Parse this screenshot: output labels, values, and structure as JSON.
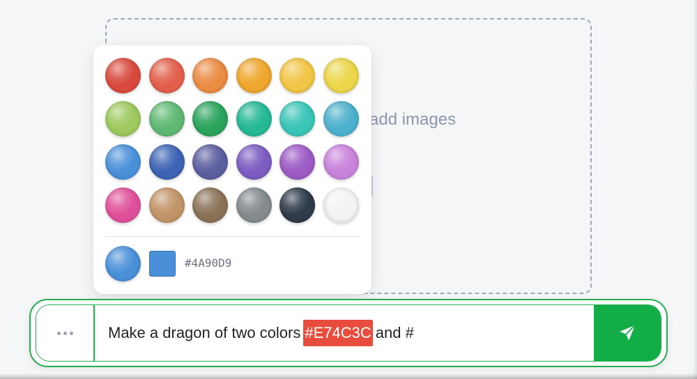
{
  "dropzone": {
    "hint_text": "n add images"
  },
  "picker": {
    "swatches": [
      {
        "name": "red",
        "color": "#d94a3d"
      },
      {
        "name": "vermilion",
        "color": "#e2604b"
      },
      {
        "name": "orange",
        "color": "#ea8c43"
      },
      {
        "name": "amber",
        "color": "#efa72e"
      },
      {
        "name": "gold",
        "color": "#f1c545"
      },
      {
        "name": "yellow",
        "color": "#ecd64a"
      },
      {
        "name": "yellow-green",
        "color": "#9dc95e"
      },
      {
        "name": "green",
        "color": "#5fb872"
      },
      {
        "name": "emerald",
        "color": "#2aa35c"
      },
      {
        "name": "turquoise",
        "color": "#25b894"
      },
      {
        "name": "teal",
        "color": "#39c5b7"
      },
      {
        "name": "sky",
        "color": "#4cb1cc"
      },
      {
        "name": "blue",
        "color": "#4a90d9"
      },
      {
        "name": "indigo",
        "color": "#3d63b4"
      },
      {
        "name": "slate-purple",
        "color": "#5c5e9f"
      },
      {
        "name": "violet",
        "color": "#7c5cc1"
      },
      {
        "name": "purple",
        "color": "#9c5bc4"
      },
      {
        "name": "orchid",
        "color": "#c983dc"
      },
      {
        "name": "pink",
        "color": "#e0509a"
      },
      {
        "name": "tan",
        "color": "#c19468"
      },
      {
        "name": "brown",
        "color": "#8a7257"
      },
      {
        "name": "gray",
        "color": "#848b8e"
      },
      {
        "name": "charcoal",
        "color": "#2f3b4a"
      },
      {
        "name": "white",
        "color": "#f3f3f3"
      }
    ],
    "selected_color": "#4a90d9",
    "hex_value": "#4A90D9"
  },
  "input": {
    "text_before": "Make a dragon of two colors",
    "color_token": "#E74C3C",
    "color_token_bg": "#e74c3c",
    "text_after": "and #"
  },
  "colors": {
    "accent": "#12ad46",
    "border": "#22ad4e"
  }
}
